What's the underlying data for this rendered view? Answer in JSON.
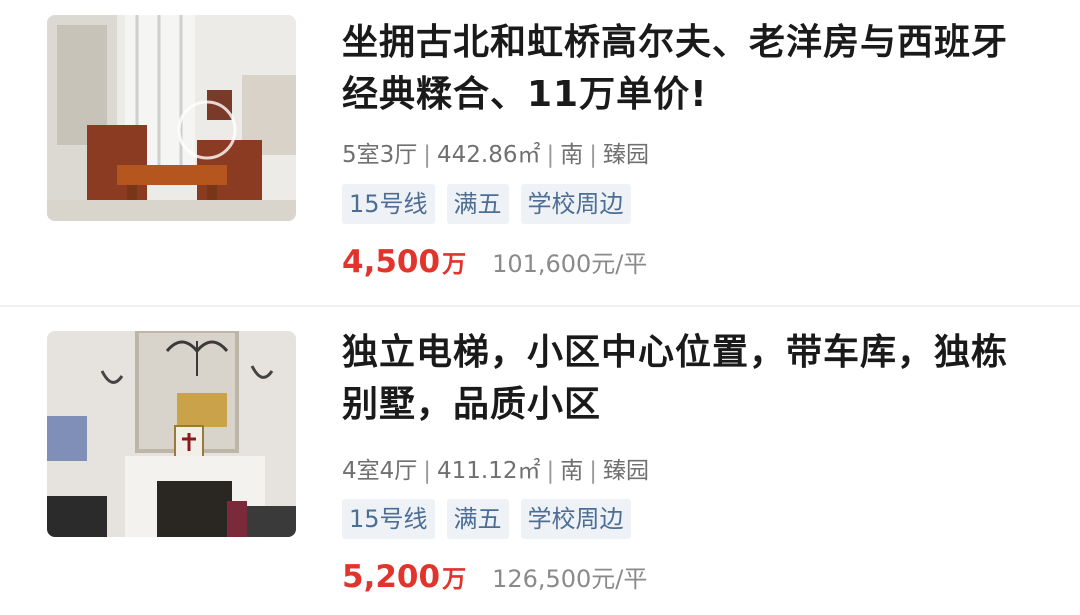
{
  "listings": [
    {
      "title": "坐拥古北和虹桥高尔夫、老洋房与西班牙经典糅合、11万单价!",
      "layout": "5室3厅",
      "area": "442.86㎡",
      "orientation": "南",
      "community": "臻园",
      "tags": [
        "15号线",
        "满五",
        "学校周边"
      ],
      "total_price": "4,500",
      "total_price_unit": "万",
      "unit_price": "101,600元/平",
      "image": "living-room-wooden-furniture-photo"
    },
    {
      "title": "独立电梯，小区中心位置，带车库，独栋别墅，品质小区",
      "layout": "4室4厅",
      "area": "411.12㎡",
      "orientation": "南",
      "community": "臻园",
      "tags": [
        "15号线",
        "满五",
        "学校周边"
      ],
      "total_price": "5,200",
      "total_price_unit": "万",
      "unit_price": "126,500元/平",
      "image": "fireplace-chandelier-room-photo"
    }
  ],
  "colors": {
    "price_red": "#e0342c",
    "tag_bg": "#eef2f6",
    "tag_text": "#4d6e94",
    "meta_gray": "#707070"
  }
}
